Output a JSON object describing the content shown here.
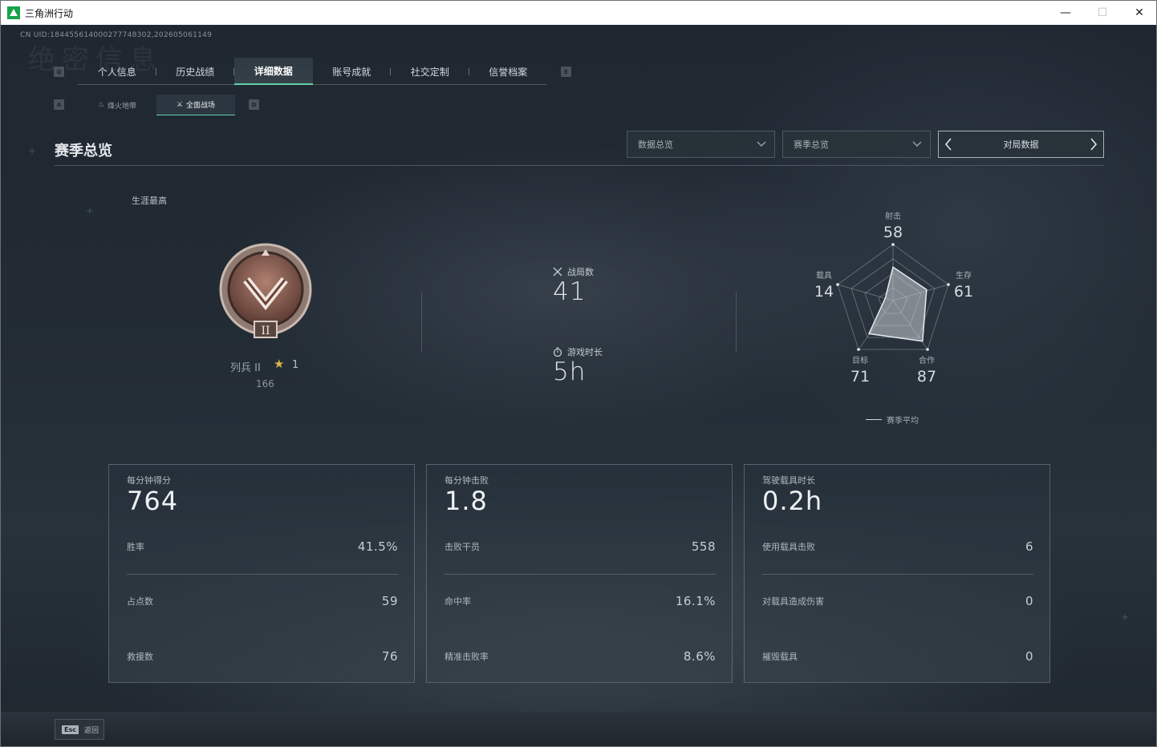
{
  "window": {
    "title": "三角洲行动",
    "minimize": "—",
    "maximize": "☐",
    "close": "✕"
  },
  "header": {
    "uid": "CN UID:184455614000277748302,202605061149",
    "ghost_title": "绝密信息",
    "left_key": "Q",
    "right_key": "E",
    "sub_left_key": "A",
    "sub_right_key": "D"
  },
  "tabs": [
    {
      "label": "个人信息",
      "active": false
    },
    {
      "label": "历史战绩",
      "active": false
    },
    {
      "label": "详细数据",
      "active": true
    },
    {
      "label": "账号成就",
      "active": false
    },
    {
      "label": "社交定制",
      "active": false
    },
    {
      "label": "信誉档案",
      "active": false
    }
  ],
  "subtabs": [
    {
      "label": "烽火地带",
      "glyph": "♨",
      "active": false
    },
    {
      "label": "全面战场",
      "glyph": "⚔",
      "active": true
    }
  ],
  "section": {
    "title": "赛季总览"
  },
  "filters": {
    "dropdown1": "数据总览",
    "dropdown2": "赛季总览",
    "pager": "对局数据"
  },
  "career": {
    "label": "生涯最高",
    "rank": "列兵 II",
    "badge_tier": "II",
    "stars": "1",
    "score": "166"
  },
  "summary": {
    "matches_label": "战局数",
    "matches_value": "41",
    "playtime_label": "游戏时长",
    "playtime_value": "5h"
  },
  "radar": {
    "axes": [
      {
        "label": "射击",
        "value": "58"
      },
      {
        "label": "生存",
        "value": "61"
      },
      {
        "label": "合作",
        "value": "87"
      },
      {
        "label": "目标",
        "value": "71"
      },
      {
        "label": "载具",
        "value": "14"
      }
    ],
    "legend": "赛季平均"
  },
  "cards": [
    {
      "head_label": "每分钟得分",
      "head_value": "764",
      "rows": [
        {
          "label": "胜率",
          "value": "41.5%"
        },
        {
          "label": "占点数",
          "value": "59"
        },
        {
          "label": "救援数",
          "value": "76"
        }
      ]
    },
    {
      "head_label": "每分钟击败",
      "head_value": "1.8",
      "rows": [
        {
          "label": "击败干员",
          "value": "558"
        },
        {
          "label": "命中率",
          "value": "16.1%"
        },
        {
          "label": "精准击败率",
          "value": "8.6%"
        }
      ]
    },
    {
      "head_label": "驾驶载具时长",
      "head_value": "0.2h",
      "rows": [
        {
          "label": "使用载具击败",
          "value": "6"
        },
        {
          "label": "对载具造成伤害",
          "value": "0"
        },
        {
          "label": "摧毁载具",
          "value": "0"
        }
      ]
    }
  ],
  "footer": {
    "esc_key": "Esc",
    "back_label": "返回"
  },
  "colors": {
    "accent": "#5fd1a6",
    "star": "#d8b64a",
    "badge": "#8a5a4c"
  }
}
